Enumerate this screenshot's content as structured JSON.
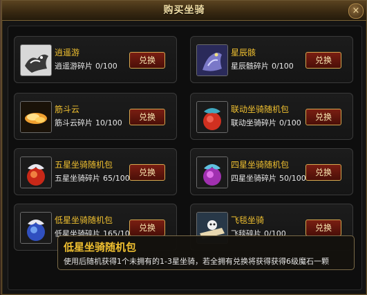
{
  "window": {
    "title": "购买坐骑",
    "close_label": "×"
  },
  "items": [
    {
      "name": "逍遥游",
      "frag_label": "逍遥游碎片",
      "count": "0/100",
      "button": "兑换",
      "icon": "xiaoyaoyou-mount-icon"
    },
    {
      "name": "星辰骸",
      "frag_label": "星辰骸碎片",
      "count": "0/100",
      "button": "兑换",
      "icon": "xingchenhai-mount-icon"
    },
    {
      "name": "筋斗云",
      "frag_label": "筋斗云碎片",
      "count": "10/100",
      "button": "兑换",
      "icon": "jindouyun-mount-icon"
    },
    {
      "name": "联动坐骑随机包",
      "frag_label": "联动坐骑碎片",
      "count": "0/100",
      "button": "兑换",
      "icon": "linked-mount-bag-icon"
    },
    {
      "name": "五星坐骑随机包",
      "frag_label": "五星坐骑碎片",
      "count": "65/100",
      "button": "兑换",
      "icon": "five-star-mount-bag-icon"
    },
    {
      "name": "四星坐骑随机包",
      "frag_label": "四星坐骑碎片",
      "count": "50/100",
      "button": "兑换",
      "icon": "four-star-mount-bag-icon"
    },
    {
      "name": "低星坐骑随机包",
      "frag_label": "低星坐骑碎片",
      "count": "165/100",
      "button": "兑换",
      "icon": "low-star-mount-bag-icon"
    },
    {
      "name": "飞毯坐骑",
      "frag_label": "飞毯碎片",
      "count": "0/100",
      "button": "兑换",
      "icon": "flying-carpet-mount-icon"
    }
  ],
  "tooltip": {
    "title": "低星坐骑随机包",
    "description": "使用后随机获得1个未拥有的1-3星坐骑，若全拥有兑换将获得获得6级魔石一颗"
  },
  "colors": {
    "item_name": "#f0c030",
    "button_border": "#d4a850",
    "button_bg": "#6a1a10"
  }
}
